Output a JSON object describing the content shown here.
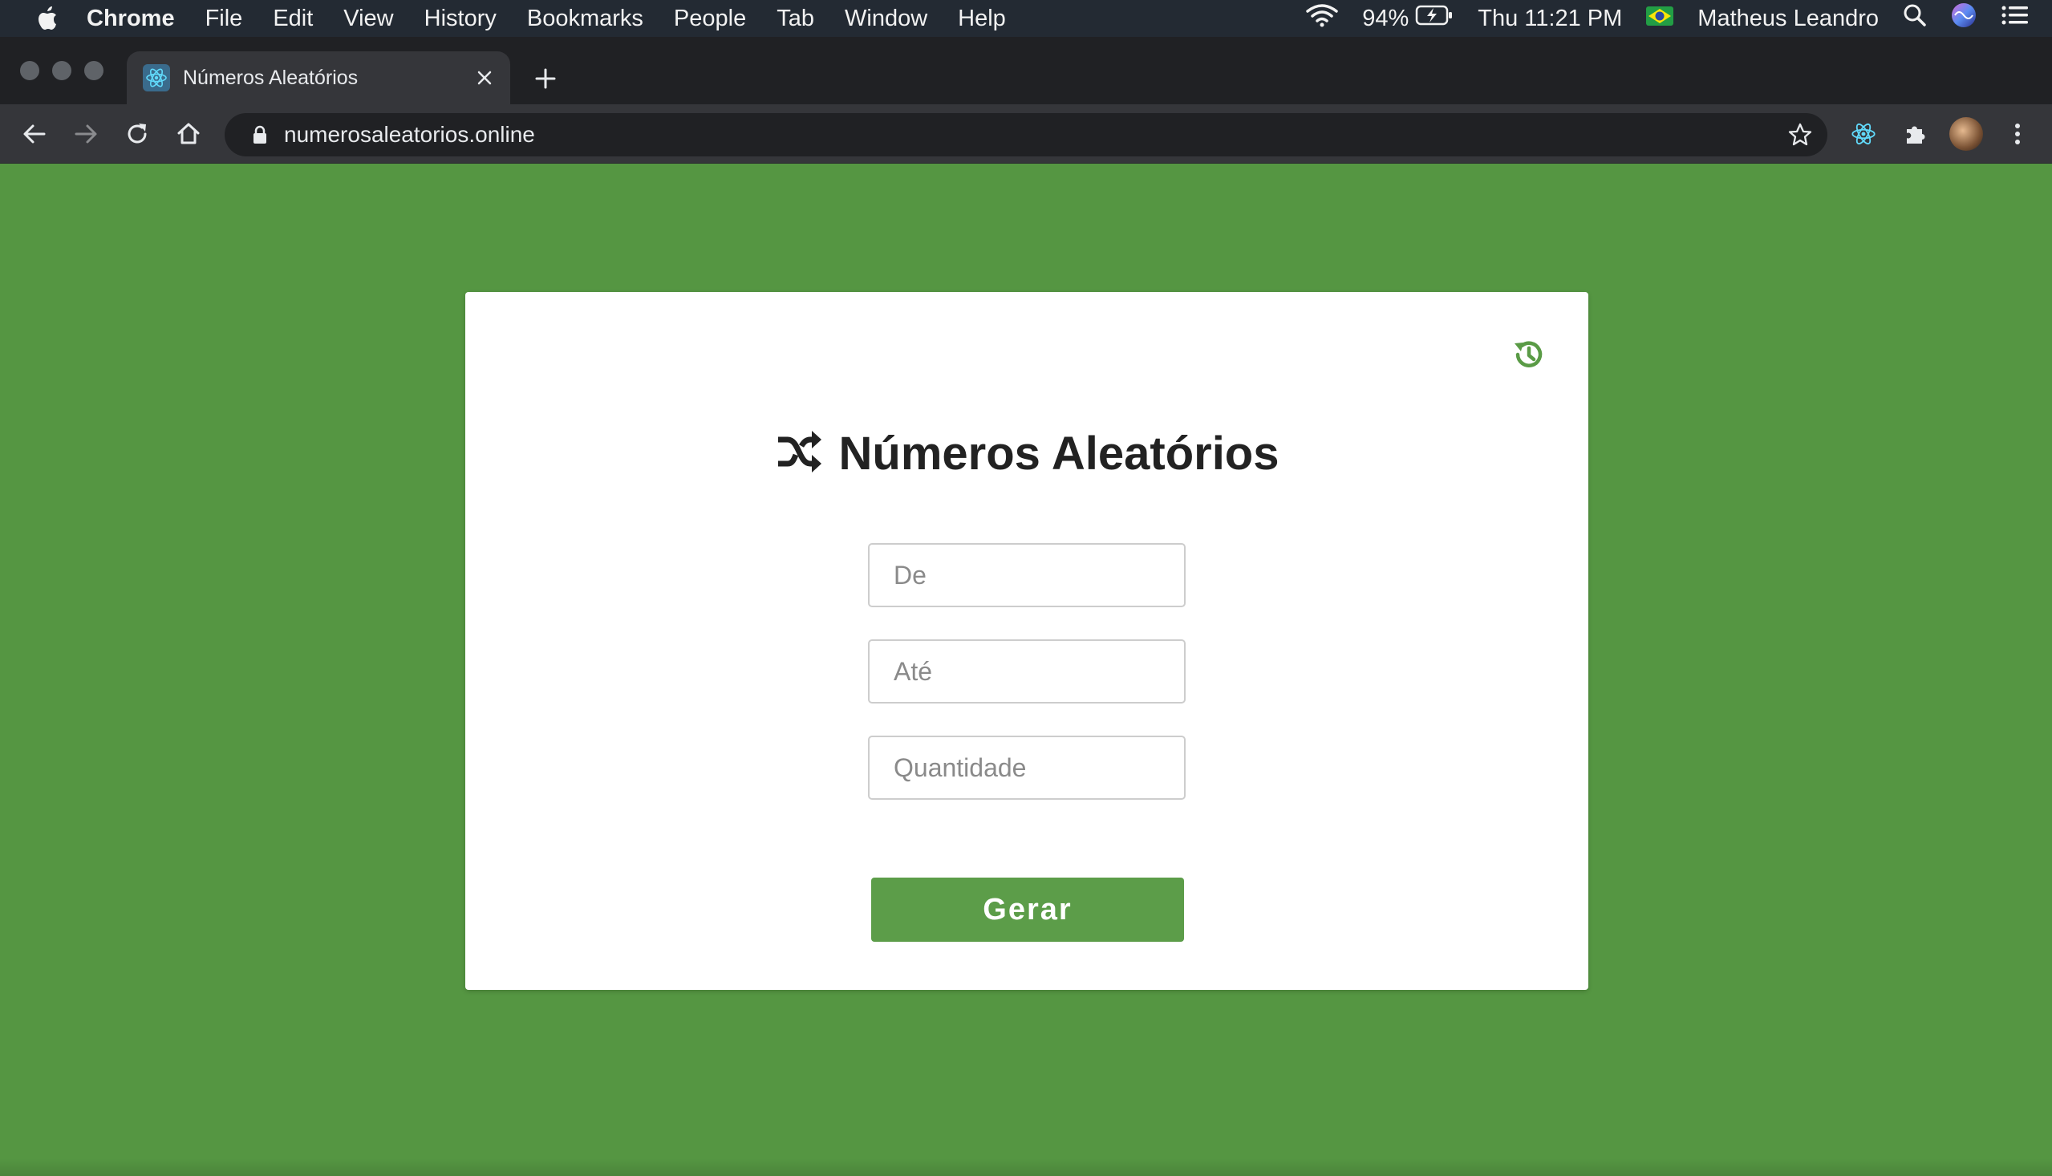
{
  "menubar": {
    "app_name": "Chrome",
    "items": [
      "File",
      "Edit",
      "View",
      "History",
      "Bookmarks",
      "People",
      "Tab",
      "Window",
      "Help"
    ],
    "battery": "94%",
    "clock": "Thu 11:21 PM",
    "user": "Matheus Leandro"
  },
  "browser": {
    "tab_title": "Números Aleatórios",
    "url": "numerosaleatorios.online"
  },
  "app": {
    "title": "Números Aleatórios",
    "fields": {
      "from_placeholder": "De",
      "to_placeholder": "Até",
      "quantity_placeholder": "Quantidade"
    },
    "generate_label": "Gerar"
  },
  "colors": {
    "page_background": "#559642",
    "button": "#5c9d49",
    "history_icon": "#5a9b46"
  }
}
